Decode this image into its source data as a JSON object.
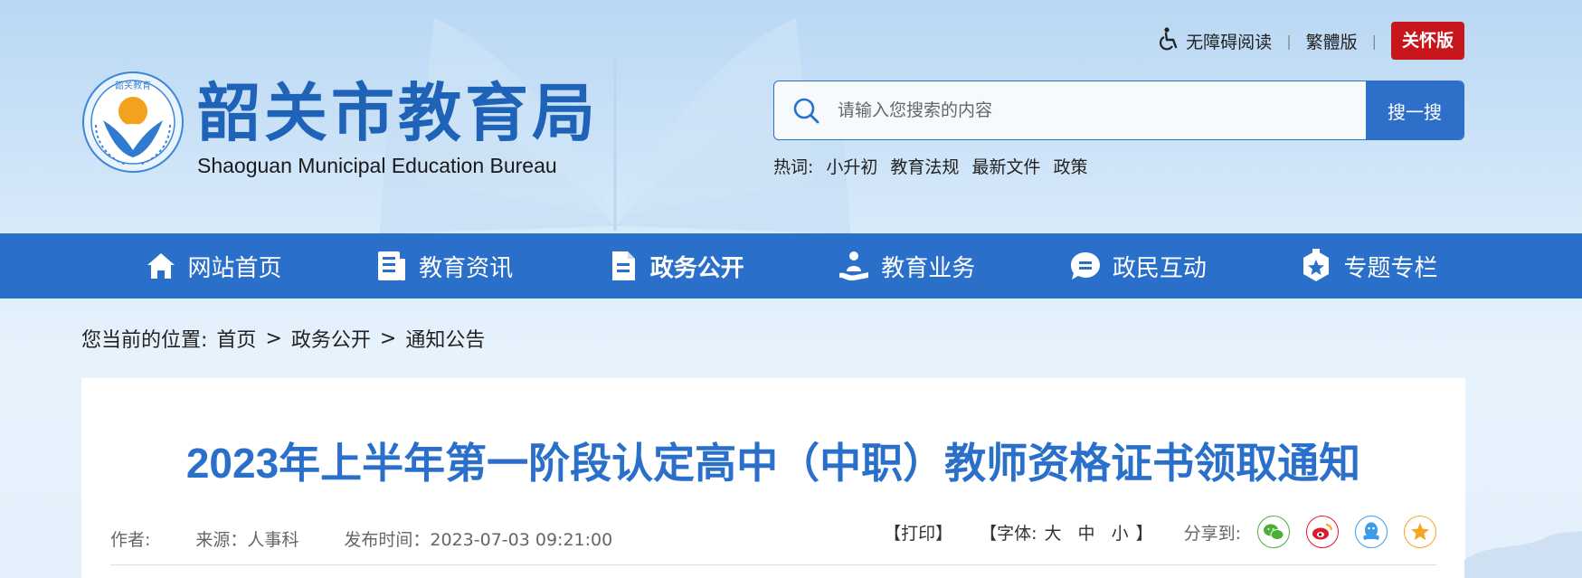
{
  "header": {
    "title": "韶关市教育局",
    "subtitle": "Shaoguan Municipal Education Bureau",
    "emblem_text": "韶关教育",
    "accessibility": "无障碍阅读",
    "traditional": "繁體版",
    "care_mode": "关怀版"
  },
  "search": {
    "placeholder": "请输入您搜索的内容",
    "button": "搜一搜",
    "hot_label": "热词:",
    "hot_words": [
      "小升初",
      "教育法规",
      "最新文件",
      "政策"
    ]
  },
  "nav": {
    "items": [
      {
        "label": "网站首页",
        "icon": "home-icon"
      },
      {
        "label": "教育资讯",
        "icon": "newspaper-icon"
      },
      {
        "label": "政务公开",
        "icon": "document-icon"
      },
      {
        "label": "教育业务",
        "icon": "person-service-icon"
      },
      {
        "label": "政民互动",
        "icon": "chat-bubble-icon"
      },
      {
        "label": "专题专栏",
        "icon": "star-badge-icon"
      }
    ],
    "active_index": 2
  },
  "breadcrumb": {
    "prefix": "您当前的位置:",
    "items": [
      "首页",
      "政务公开",
      "通知公告"
    ],
    "separator": ">"
  },
  "article": {
    "title": "2023年上半年第一阶段认定高中（中职）教师资格证书领取通知",
    "author_label": "作者:",
    "source": "来源：人事科",
    "published": "发布时间：2023-07-03 09:21:00",
    "print": "【打印】",
    "font_label": "【字体:",
    "font_large": "大",
    "font_medium": "中",
    "font_small": "小",
    "font_close": "】",
    "share_label": "分享到:",
    "share": [
      "wechat-icon",
      "weibo-icon",
      "qq-icon",
      "qzone-icon"
    ]
  },
  "colors": {
    "brand_blue": "#2a6fc9",
    "care_red": "#c8161d",
    "wechat": "#4cae34",
    "weibo": "#e6162d",
    "qq": "#3a9bea",
    "qzone": "#f5a623"
  }
}
